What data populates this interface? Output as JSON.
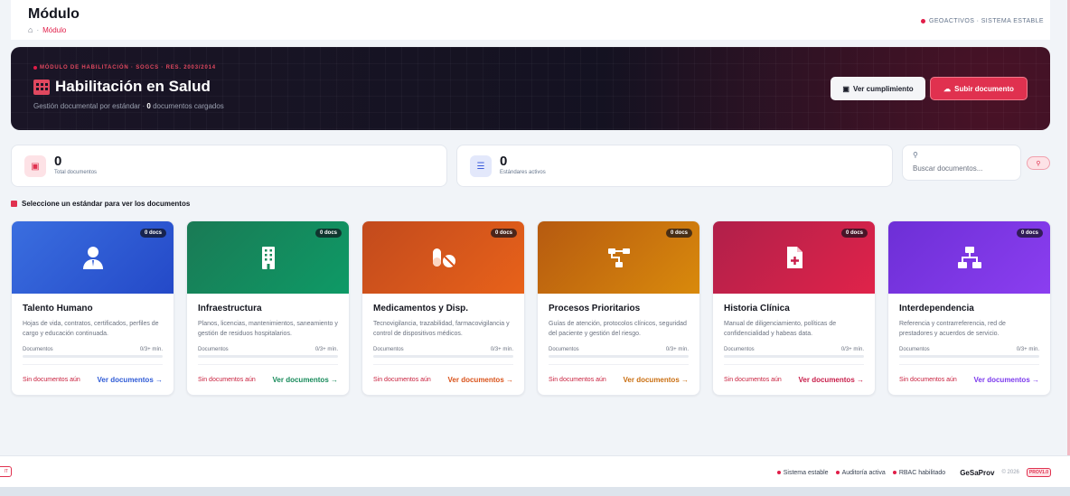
{
  "header": {
    "title": "Módulo",
    "breadcrumb_current": "Módulo",
    "system_status": "GEOACTIVOS · SISTEMA ESTABLE"
  },
  "hero": {
    "kicker": "MÓDULO DE HABILITACIÓN · SOGCS · RES. 2003/2014",
    "title": "Habilitación en Salud",
    "subtitle_prefix": "Gestión documental por estándar · ",
    "doc_count": "0",
    "subtitle_suffix": " documentos cargados",
    "btn_cumplimiento": "Ver cumplimiento",
    "btn_subir": "Subir documento"
  },
  "stats": {
    "total_docs": {
      "value": "0",
      "label": "Total documentos"
    },
    "standards": {
      "value": "0",
      "label": "Estándares activos"
    }
  },
  "search": {
    "placeholder": "Buscar documentos..."
  },
  "section_label": "Seleccione un estándar para ver los documentos",
  "cards": [
    {
      "title": "Talento Humano",
      "badge": "0 docs",
      "desc": "Hojas de vida, contratos, certificados, perfiles de cargo y educación continuada.",
      "progress_label": "Documentos",
      "progress_value": "0/3+ mín.",
      "empty": "Sin documentos aún",
      "link": "Ver documentos →",
      "color": "#2f5bd6"
    },
    {
      "title": "Infraestructura",
      "badge": "0 docs",
      "desc": "Planos, licencias, mantenimientos, saneamiento y gestión de residuos hospitalarios.",
      "progress_label": "Documentos",
      "progress_value": "0/3+ mín.",
      "empty": "Sin documentos aún",
      "link": "Ver documentos →",
      "color": "#178a5a"
    },
    {
      "title": "Medicamentos y Disp.",
      "badge": "0 docs",
      "desc": "Tecnovigilancia, trazabilidad, farmacovigilancia y control de dispositivos médicos.",
      "progress_label": "Documentos",
      "progress_value": "0/3+ mín.",
      "empty": "Sin documentos aún",
      "link": "Ver documentos →",
      "color": "#d9531b"
    },
    {
      "title": "Procesos Prioritarios",
      "badge": "0 docs",
      "desc": "Guías de atención, protocolos clínicos, seguridad del paciente y gestión del riesgo.",
      "progress_label": "Documentos",
      "progress_value": "0/3+ mín.",
      "empty": "Sin documentos aún",
      "link": "Ver documentos →",
      "color": "#c96e10"
    },
    {
      "title": "Historia Clínica",
      "badge": "0 docs",
      "desc": "Manual de diligenciamiento, políticas de confidencialidad y habeas data.",
      "progress_label": "Documentos",
      "progress_value": "0/3+ mín.",
      "empty": "Sin documentos aún",
      "link": "Ver documentos →",
      "color": "#c81e4a"
    },
    {
      "title": "Interdependencia",
      "badge": "0 docs",
      "desc": "Referencia y contrarreferencia, red de prestadores y acuerdos de servicio.",
      "progress_label": "Documentos",
      "progress_value": "0/3+ mín.",
      "empty": "Sin documentos aún",
      "link": "Ver documentos →",
      "color": "#7c3aed"
    }
  ],
  "footer": {
    "left_badge": "IT",
    "items": [
      "Sistema estable",
      "Auditoría activa",
      "RBAC habilitado"
    ],
    "brand": "GeSaProv",
    "copy": "© 2026",
    "version": "PROV1.0"
  }
}
